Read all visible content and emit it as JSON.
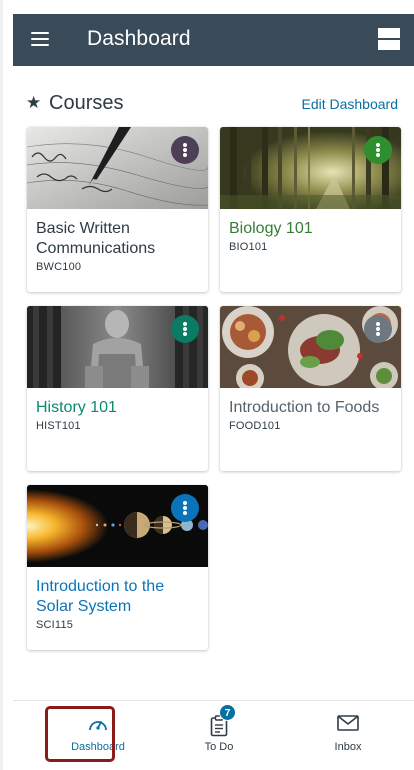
{
  "header": {
    "title": "Dashboard",
    "menu_icon": "hamburger-icon",
    "layout_icon": "layout-toggle-icon",
    "bg_color": "#394b58"
  },
  "courses_section": {
    "title": "Courses",
    "star_icon": "★",
    "edit_label": "Edit Dashboard"
  },
  "courses": [
    {
      "title": "Basic Written Communications",
      "code": "BWC100",
      "color": "#2d3b45",
      "menu_color": "#4d3f56",
      "image": "pen-on-paper"
    },
    {
      "title": "Biology 101",
      "code": "BIO101",
      "color": "#347f35",
      "menu_color": "#2f8f2e",
      "image": "forest"
    },
    {
      "title": "History 101",
      "code": "HIST101",
      "color": "#0b8a6e",
      "menu_color": "#0b7c63",
      "image": "lincoln-statue"
    },
    {
      "title": "Introduction to Foods",
      "code": "FOOD101",
      "color": "#54626d",
      "menu_color": "#6e7880",
      "image": "food-plates"
    },
    {
      "title": "Introduction to the Solar System",
      "code": "SCI115",
      "color": "#0b74b8",
      "menu_color": "#0b74b8",
      "image": "solar-system"
    }
  ],
  "bottom_nav": {
    "dashboard_label": "Dashboard",
    "todo_label": "To Do",
    "todo_badge": "7",
    "inbox_label": "Inbox",
    "active_color": "#0770a3",
    "highlight_color": "#8b1a1a"
  }
}
